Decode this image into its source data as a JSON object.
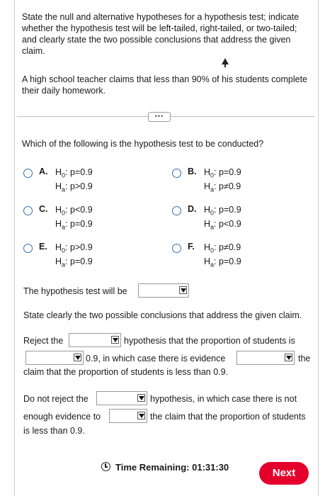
{
  "instructions": "State the null and alternative hypotheses for a hypothesis test; indicate whether the hypothesis test will be left-tailed, right-tailed, or two-tailed; and clearly state the two possible conclusions that address the given claim.",
  "claim": "A high school teacher claims that less than 90% of his students complete their daily homework.",
  "question": "Which of the following is the hypothesis test to be conducted?",
  "options": [
    {
      "letter": "A.",
      "h0": "p=0.9",
      "ha": "p>0.9"
    },
    {
      "letter": "B.",
      "h0": "p=0.9",
      "ha": "p≠0.9"
    },
    {
      "letter": "C.",
      "h0": "p<0.9",
      "ha": "p=0.9"
    },
    {
      "letter": "D.",
      "h0": "p=0.9",
      "ha": "p<0.9"
    },
    {
      "letter": "E.",
      "h0": "p>0.9",
      "ha": "p=0.9"
    },
    {
      "letter": "F.",
      "h0": "p≠0.9",
      "ha": "p=0.9"
    }
  ],
  "symbols": {
    "h0_label": "H",
    "h0_sub": "0",
    "ha_label": "H",
    "ha_sub": "a",
    "colon": ":"
  },
  "test_line": "The hypothesis test will be",
  "conclusions_prompt": "State clearly the two possible conclusions that address the given claim.",
  "reject": {
    "part1": "Reject the",
    "part2": "hypothesis that the proportion of students is",
    "part3": "0.9, in which case there is evidence",
    "part4": "the",
    "part5": "claim that the proportion of students is less than 0.9."
  },
  "not_reject": {
    "part1": "Do not reject the",
    "part2": "hypothesis, in which case there is not",
    "part3": "enough evidence to",
    "part4": "the claim that the proportion of students",
    "part5": "is less than 0.9."
  },
  "footer": {
    "timer_label": "Time Remaining: 01:31:30",
    "next_label": "Next"
  },
  "colors": {
    "accent": "#e4002b",
    "radio": "#2f6fb0"
  }
}
